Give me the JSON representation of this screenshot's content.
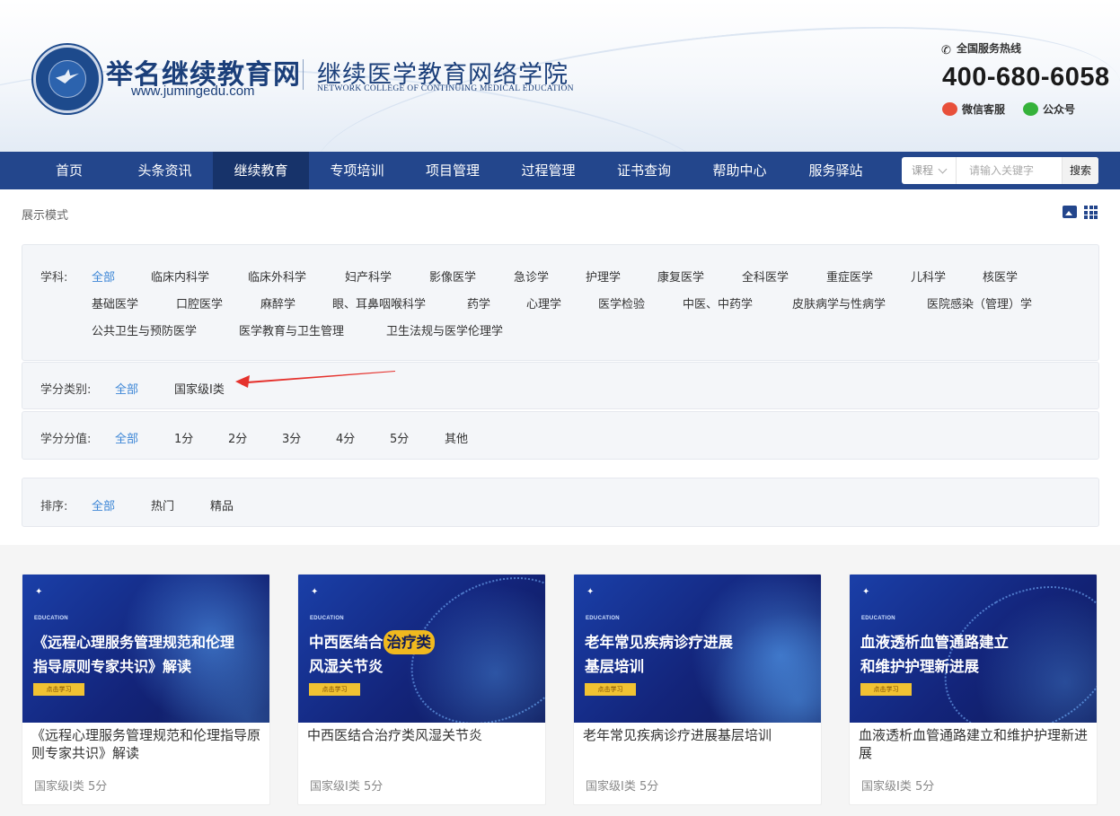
{
  "header": {
    "site_name": "举名继续教育网",
    "site_url": "www.jumingedu.com",
    "college_cn": "继续医学教育网络学院",
    "college_en": "NETWORK COLLEGE OF CONTINUING MEDICAL EDUCATION",
    "hotline_label": "全国服务热线",
    "hotline_number": "400-680-6058",
    "wechat_service": "微信客服",
    "official_account": "公众号"
  },
  "nav": {
    "items": [
      "首页",
      "头条资讯",
      "继续教育",
      "专项培训",
      "项目管理",
      "过程管理",
      "证书查询",
      "帮助中心",
      "服务驿站"
    ],
    "active": "继续教育"
  },
  "search": {
    "select_value": "课程",
    "placeholder": "请输入关键字",
    "button": "搜索"
  },
  "display_mode": {
    "label": "展示模式"
  },
  "filters": {
    "subject": {
      "label": "学科:",
      "options": [
        "全部",
        "临床内科学",
        "临床外科学",
        "妇产科学",
        "影像医学",
        "急诊学",
        "护理学",
        "康复医学",
        "全科医学",
        "重症医学",
        "儿科学",
        "核医学",
        "基础医学",
        "口腔医学",
        "麻醉学",
        "眼、耳鼻咽喉科学",
        "药学",
        "心理学",
        "医学检验",
        "中医、中药学",
        "皮肤病学与性病学",
        "医院感染（管理）学",
        "公共卫生与预防医学",
        "医学教育与卫生管理",
        "卫生法规与医学伦理学"
      ],
      "selected": "全部"
    },
    "credit_type": {
      "label": "学分类别:",
      "options": [
        "全部",
        "国家级I类"
      ],
      "selected": "全部"
    },
    "credit_value": {
      "label": "学分分值:",
      "options": [
        "全部",
        "1分",
        "2分",
        "3分",
        "4分",
        "5分",
        "其他"
      ],
      "selected": "全部"
    },
    "sort": {
      "label": "排序:",
      "options": [
        "全部",
        "热门",
        "精品"
      ],
      "selected": "全部"
    }
  },
  "courses": [
    {
      "banner_line1": "《远程心理服务管理规范和伦理",
      "banner_line2": "指导原则专家共识》解读",
      "banner_tag": "EDUCATION",
      "cta": "点击学习",
      "title": "《远程心理服务管理规范和伦理指导原则专家共识》解读",
      "meta": "国家级I类 5分"
    },
    {
      "banner_line1a": "中西医结合",
      "banner_line1b": "治疗类",
      "banner_line2": "风湿关节炎",
      "banner_tag": "EDUCATION",
      "cta": "点击学习",
      "title": "中西医结合治疗类风湿关节炎",
      "meta": "国家级I类 5分"
    },
    {
      "banner_line1": "老年常见疾病诊疗进展",
      "banner_line2": "基层培训",
      "banner_tag": "EDUCATION",
      "cta": "点击学习",
      "title": "老年常见疾病诊疗进展基层培训",
      "meta": "国家级I类 5分"
    },
    {
      "banner_line1": "血液透析血管通路建立",
      "banner_line2": "和维护护理新进展",
      "banner_tag": "EDUCATION",
      "cta": "点击学习",
      "title": "血液透析血管通路建立和维护护理新进展",
      "meta": "国家级I类 5分"
    }
  ],
  "colors": {
    "nav_bg": "#23468c",
    "nav_active": "#17336a",
    "accent_link": "#3c86d6",
    "annotation_arrow": "#e5322d"
  }
}
